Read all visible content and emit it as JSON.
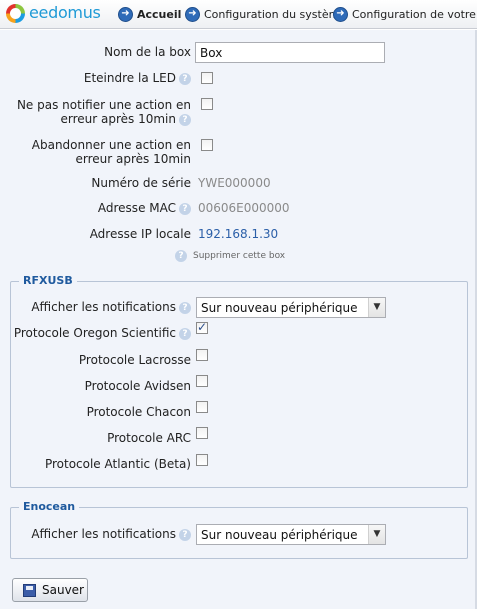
{
  "header": {
    "logo": "eedomus",
    "breadcrumbs": [
      "Accueil",
      "Configuration du système",
      "Configuration de votre box"
    ]
  },
  "box_settings": {
    "name_label": "Nom de la box",
    "name_value": "Box",
    "led_label": "Eteindre la LED",
    "notify_label_line1": "Ne pas notifier une action en",
    "notify_label_line2": "erreur après 10min",
    "abandon_label_line1": "Abandonner une action en",
    "abandon_label_line2": "erreur après 10min",
    "serial_label": "Numéro de série",
    "serial_value": "YWE000000",
    "mac_label": "Adresse MAC",
    "mac_value": "00606E000000",
    "ip_label": "Adresse IP locale",
    "ip_value": "192.168.1.30",
    "delete_link": "Supprimer cette box"
  },
  "rfxusb": {
    "legend": "RFXUSB",
    "notifications_label": "Afficher les notifications",
    "notifications_value": "Sur nouveau périphérique",
    "protocols": [
      {
        "label": "Protocole Oregon Scientific",
        "checked": true
      },
      {
        "label": "Protocole Lacrosse",
        "checked": false
      },
      {
        "label": "Protocole Avidsen",
        "checked": false
      },
      {
        "label": "Protocole Chacon",
        "checked": false
      },
      {
        "label": "Protocole ARC",
        "checked": false
      },
      {
        "label": "Protocole Atlantic (Beta)",
        "checked": false
      }
    ]
  },
  "enocean": {
    "legend": "Enocean",
    "notifications_label": "Afficher les notifications",
    "notifications_value": "Sur nouveau périphérique"
  },
  "save_label": "Sauver",
  "colors": {
    "accent": "#1f5a9e",
    "link": "#2b5fa8",
    "background": "#f1f4fa"
  }
}
